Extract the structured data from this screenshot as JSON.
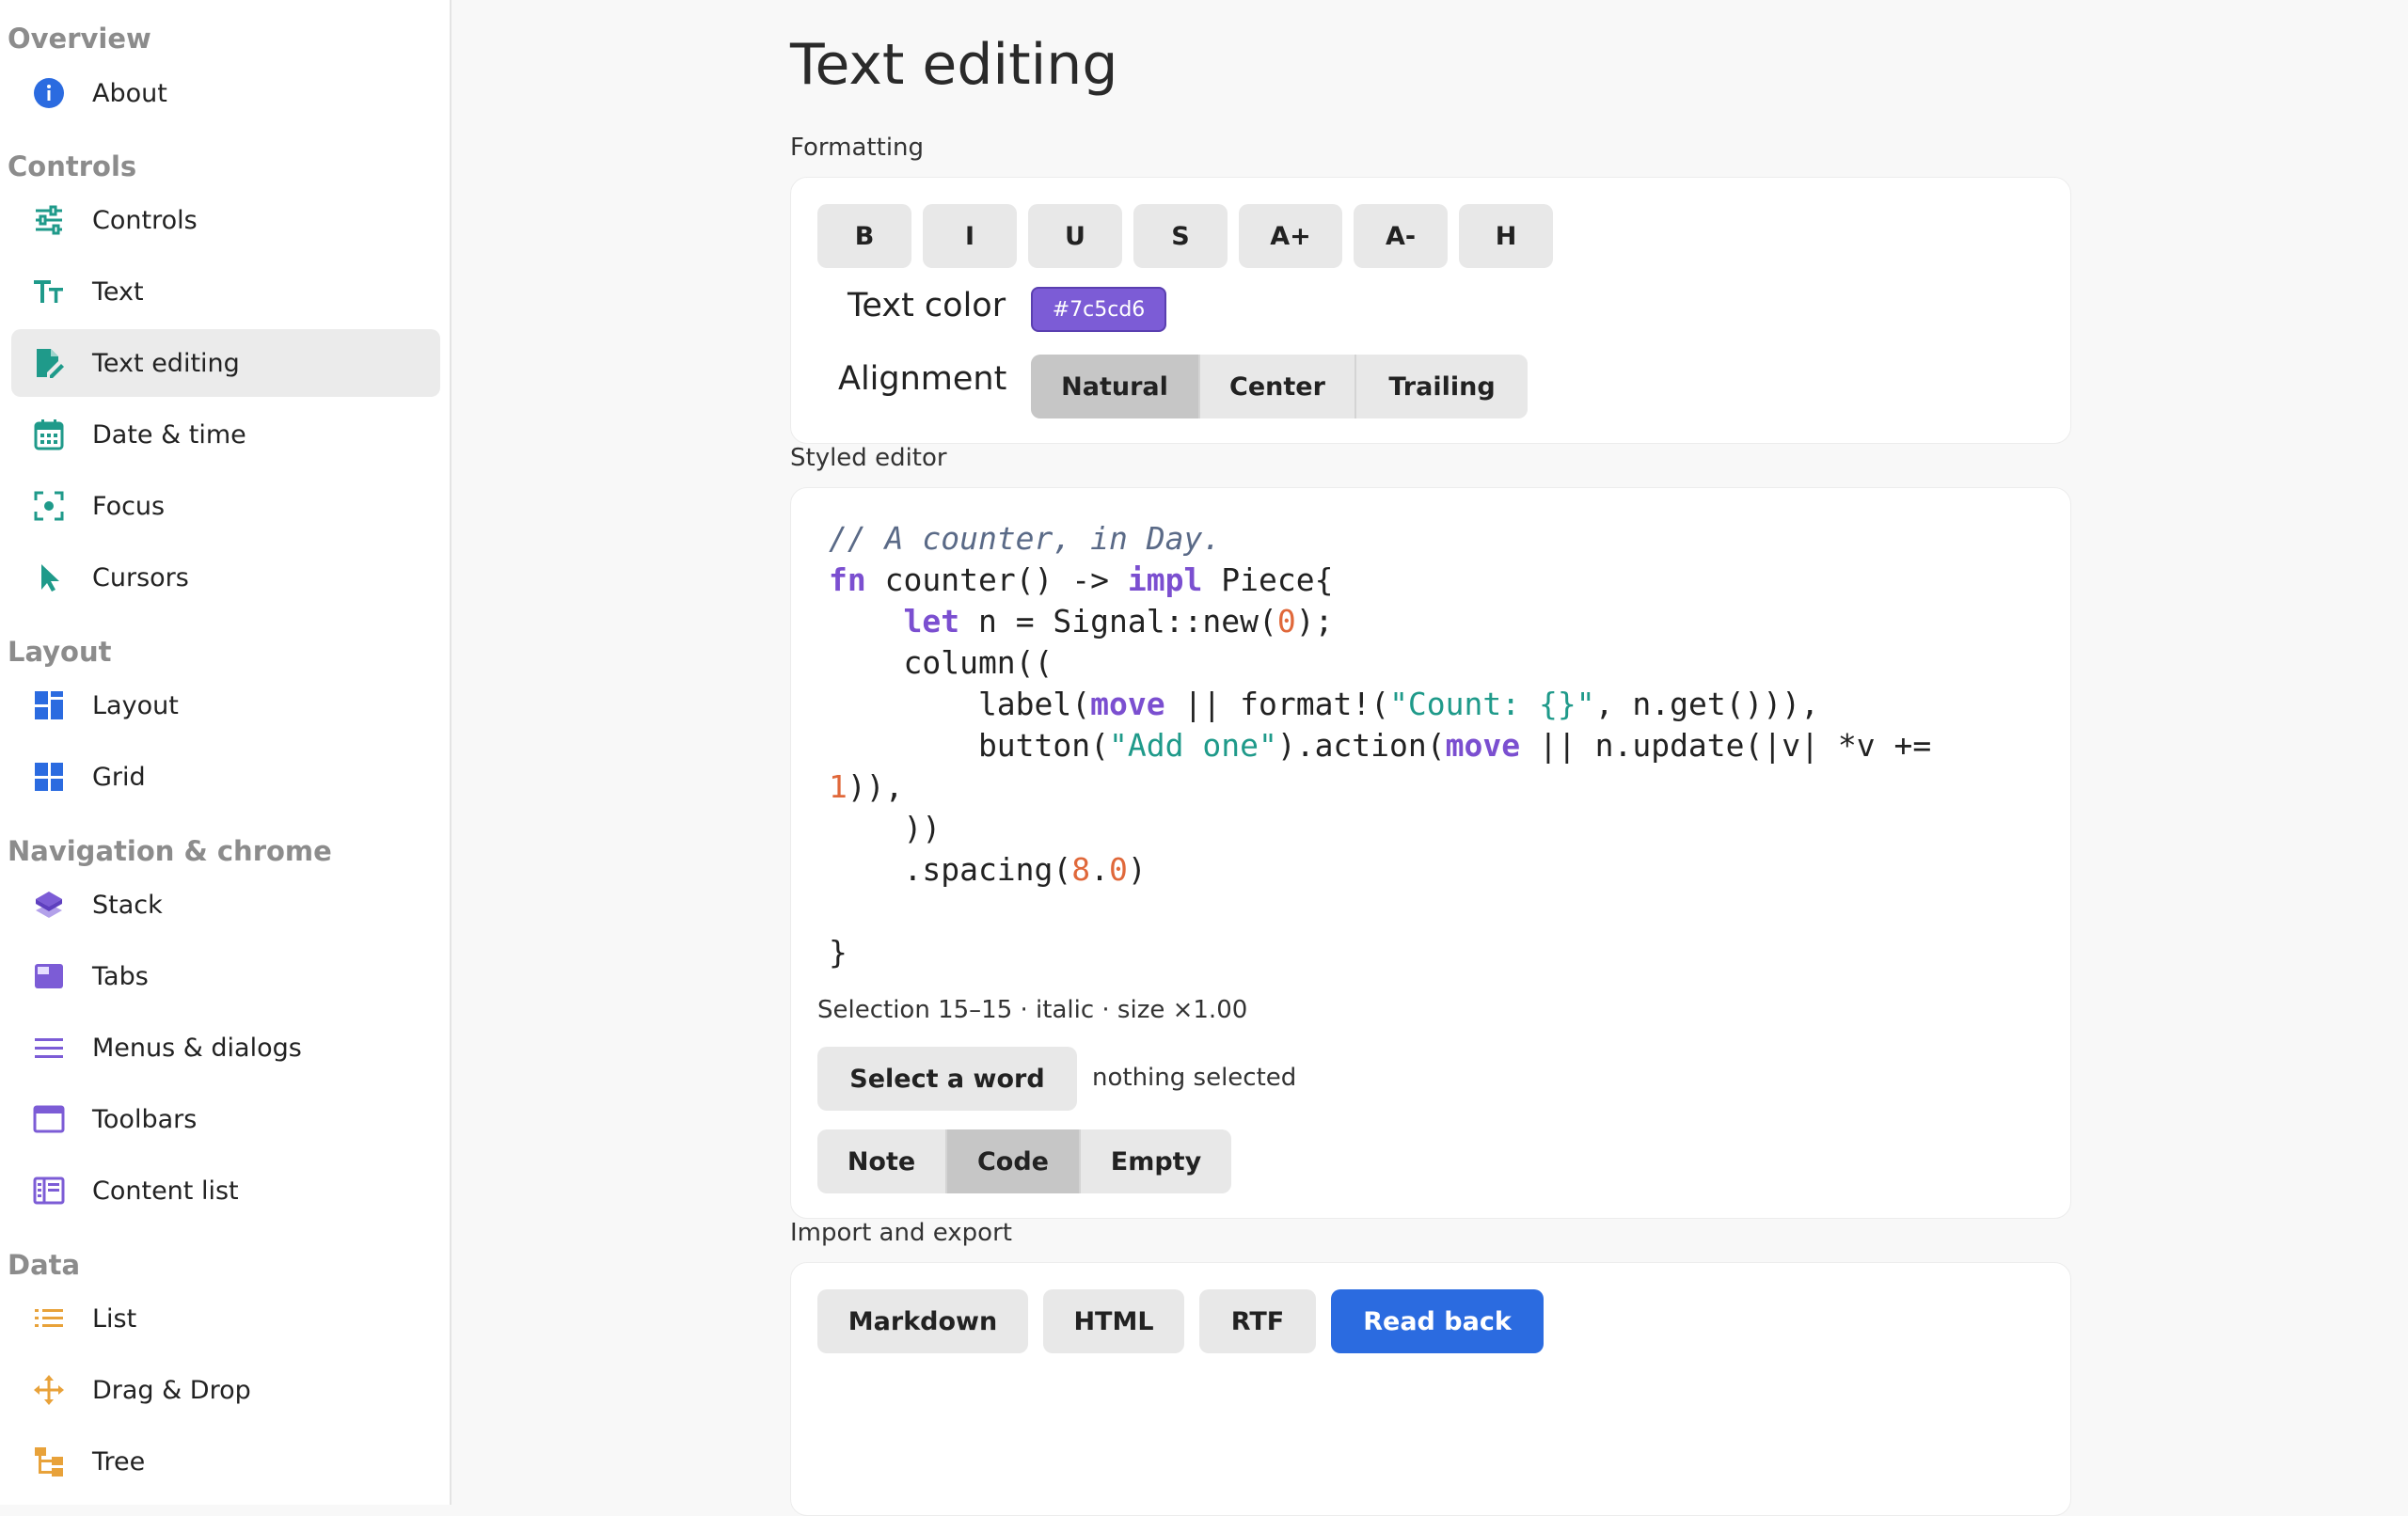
{
  "sidebar": {
    "sections": {
      "overview": "Overview",
      "controls": "Controls",
      "layout": "Layout",
      "navigation": "Navigation & chrome",
      "data": "Data"
    },
    "items": [
      {
        "label": "About",
        "icon": "info-icon"
      },
      {
        "label": "Controls",
        "icon": "sliders-icon"
      },
      {
        "label": "Text",
        "icon": "text-size-icon"
      },
      {
        "label": "Text editing",
        "icon": "edit-document-icon",
        "selected": true
      },
      {
        "label": "Date & time",
        "icon": "calendar-icon"
      },
      {
        "label": "Focus",
        "icon": "focus-icon"
      },
      {
        "label": "Cursors",
        "icon": "cursor-icon"
      },
      {
        "label": "Layout",
        "icon": "layout-icon"
      },
      {
        "label": "Grid",
        "icon": "grid-icon"
      },
      {
        "label": "Stack",
        "icon": "stack-icon"
      },
      {
        "label": "Tabs",
        "icon": "tabs-icon"
      },
      {
        "label": "Menus & dialogs",
        "icon": "menu-icon"
      },
      {
        "label": "Toolbars",
        "icon": "toolbar-icon"
      },
      {
        "label": "Content list",
        "icon": "content-list-icon"
      },
      {
        "label": "List",
        "icon": "list-icon"
      },
      {
        "label": "Drag & Drop",
        "icon": "move-icon"
      },
      {
        "label": "Tree",
        "icon": "tree-icon"
      }
    ]
  },
  "page": {
    "title": "Text editing"
  },
  "formatting": {
    "label": "Formatting",
    "buttons": [
      "B",
      "I",
      "U",
      "S",
      "A+",
      "A-",
      "H"
    ],
    "text_color_label": "Text color",
    "text_color_value": "#7c5cd6",
    "alignment_label": "Alignment",
    "alignment_options": [
      "Natural",
      "Center",
      "Trailing"
    ],
    "alignment_selected": "Natural"
  },
  "styled_editor": {
    "label": "Styled editor",
    "code_lines": [
      "// A counter, in Day.",
      "fn counter() -> impl Piece{",
      "    let n = Signal::new(0);",
      "    column((",
      "        label(move || format!(\"Count: {}\", n.get())),",
      "        button(\"Add one\").action(move || n.update(|v| *v +=",
      "1)),",
      "    ))",
      "    .spacing(8.0)",
      "",
      "}"
    ],
    "selection_status": "Selection 15–15 · italic · size ×1.00",
    "select_word_button": "Select a word",
    "selection_text": "nothing selected",
    "presets": [
      "Note",
      "Code",
      "Empty"
    ],
    "preset_selected": "Code"
  },
  "import_export": {
    "label": "Import and export",
    "buttons": [
      "Markdown",
      "HTML",
      "RTF"
    ],
    "read_back_button": "Read back"
  },
  "colors": {
    "accent": "#2b6be0",
    "purple": "#7c5cd6",
    "teal": "#1f9a8a",
    "orange": "#e8a23a",
    "code_keyword": "#7b4fd0",
    "code_number": "#e0683a",
    "code_comment": "#5a6a87"
  }
}
